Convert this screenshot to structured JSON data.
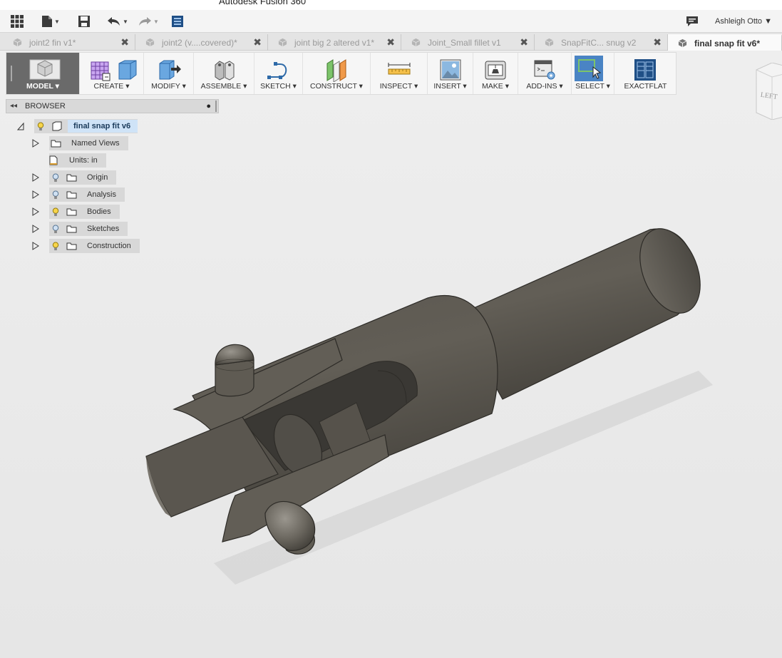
{
  "window": {
    "title": "Autodesk Fusion 360"
  },
  "appbar": {
    "icons": [
      "grid-icon",
      "file-icon",
      "save-icon",
      "undo-icon",
      "redo-icon",
      "data-panel-icon"
    ],
    "notification_icon": "comment-icon",
    "user": "Ashleigh Otto ▼"
  },
  "tabs": [
    {
      "label": "joint2 fin v1*",
      "close": "✖",
      "active": false
    },
    {
      "label": "joint2 (v....covered)*",
      "close": "✖",
      "active": false
    },
    {
      "label": "joint big 2 altered v1*",
      "close": "✖",
      "active": false
    },
    {
      "label": "Joint_Small fillet v1",
      "close": "✖",
      "active": false
    },
    {
      "label": "SnapFitC... snug v2",
      "close": "✖",
      "active": false
    },
    {
      "label": "final snap fit v6*",
      "active": true
    }
  ],
  "toolbar": {
    "model": "MODEL ▾",
    "create": "CREATE ▾",
    "modify": "MODIFY ▾",
    "assemble": "ASSEMBLE ▾",
    "sketch": "SKETCH ▾",
    "construct": "CONSTRUCT ▾",
    "inspect": "INSPECT ▾",
    "insert": "INSERT ▾",
    "make": "MAKE ▾",
    "addins": "ADD-INS ▾",
    "select": "SELECT ▾",
    "exactflat": "EXACTFLAT"
  },
  "browser": {
    "title": "BROWSER",
    "root": "final snap fit v6",
    "items": [
      {
        "label": "Named Views"
      },
      {
        "label": "Units: in"
      },
      {
        "label": "Origin"
      },
      {
        "label": "Analysis"
      },
      {
        "label": "Bodies"
      },
      {
        "label": "Sketches"
      },
      {
        "label": "Construction"
      }
    ]
  },
  "viewcube": {
    "face": "LEFT"
  },
  "colors": {
    "accent_blue": "#4a84c4",
    "model_tab": "#6a6a6a",
    "body": "#5e5a52",
    "root_highlight": "#cfe3f7"
  }
}
